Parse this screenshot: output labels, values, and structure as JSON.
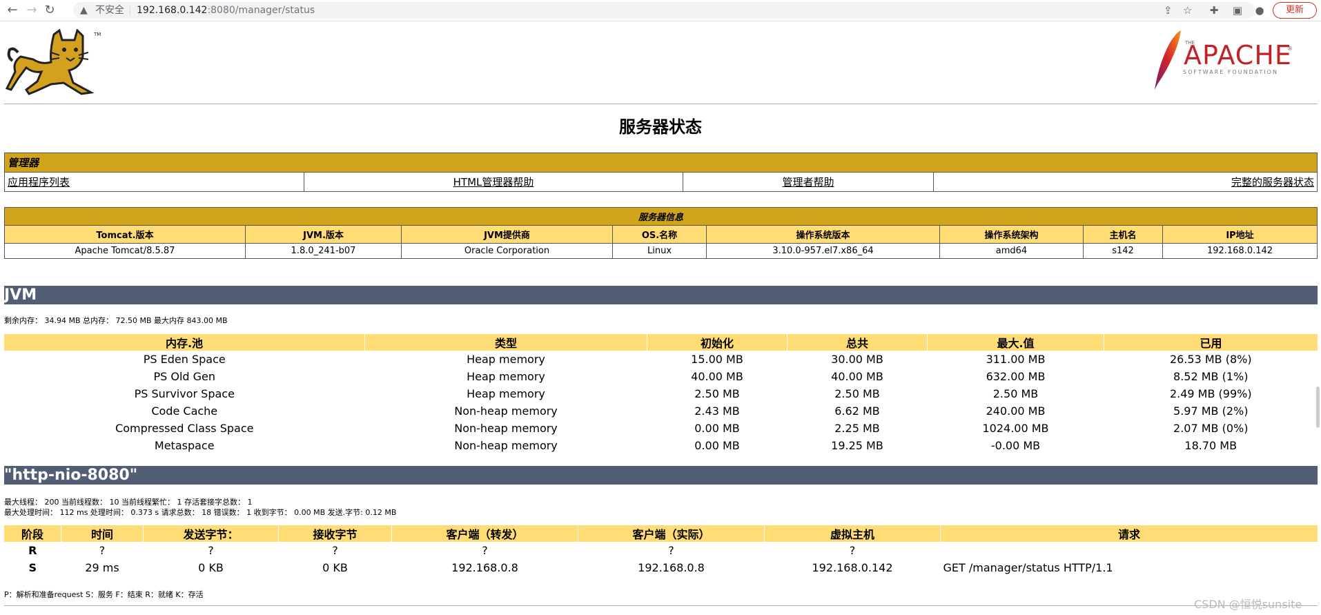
{
  "browser": {
    "security": "不安全",
    "url_host": "192.168.0.142",
    "url_path": ":8080/manager/status",
    "update_label": "更新"
  },
  "header": {
    "apache_the": "THE",
    "apache_name": "APACHE",
    "apache_sub": "SOFTWARE FOUNDATION",
    "apache_tm": "®"
  },
  "page_title": "服务器状态",
  "manager": {
    "title": "管理器",
    "links": [
      "应用程序列表",
      "HTML管理器帮助",
      "管理者帮助",
      "完整的服务器状态"
    ]
  },
  "server_info": {
    "title": "服务器信息",
    "headers": [
      "Tomcat.版本",
      "JVM.版本",
      "JVM提供商",
      "OS.名称",
      "操作系统版本",
      "操作系统架构",
      "主机名",
      "IP地址"
    ],
    "values": [
      "Apache Tomcat/8.5.87",
      "1.8.0_241-b07",
      "Oracle Corporation",
      "Linux",
      "3.10.0-957.el7.x86_64",
      "amd64",
      "s142",
      "192.168.0.142"
    ]
  },
  "jvm": {
    "title": "JVM",
    "memory_line": "剩余内存： 34.94 MB 总内存： 72.50 MB 最大内存 843.00 MB",
    "headers": [
      "内存.池",
      "类型",
      "初始化",
      "总共",
      "最大.值",
      "已用"
    ],
    "rows": [
      [
        "PS Eden Space",
        "Heap memory",
        "15.00 MB",
        "30.00 MB",
        "311.00 MB",
        "26.53 MB (8%)"
      ],
      [
        "PS Old Gen",
        "Heap memory",
        "40.00 MB",
        "40.00 MB",
        "632.00 MB",
        "8.52 MB (1%)"
      ],
      [
        "PS Survivor Space",
        "Heap memory",
        "2.50 MB",
        "2.50 MB",
        "2.50 MB",
        "2.49 MB (99%)"
      ],
      [
        "Code Cache",
        "Non-heap memory",
        "2.43 MB",
        "6.62 MB",
        "240.00 MB",
        "5.97 MB (2%)"
      ],
      [
        "Compressed Class Space",
        "Non-heap memory",
        "0.00 MB",
        "2.25 MB",
        "1024.00 MB",
        "2.07 MB (0%)"
      ],
      [
        "Metaspace",
        "Non-heap memory",
        "0.00 MB",
        "19.25 MB",
        "-0.00 MB",
        "18.70 MB"
      ]
    ]
  },
  "connector": {
    "title": "\"http-nio-8080\"",
    "line1": "最大线程： 200 当前线程数： 10 当前线程繁忙： 1 存活套接字总数： 1",
    "line2": "最大处理时间： 112 ms 处理时间： 0.373 s 请求总数： 18 错误数： 1 收到字节： 0.00 MB 发送.字节: 0.12 MB",
    "headers": [
      "阶段",
      "时间",
      "发送字节：",
      "接收字节",
      "客户端（转发）",
      "客户端（实际）",
      "虚拟主机",
      "请求"
    ],
    "rows": [
      [
        "R",
        "?",
        "?",
        "?",
        "?",
        "?",
        "?",
        ""
      ],
      [
        "S",
        "29 ms",
        "0 KB",
        "0 KB",
        "192.168.0.8",
        "192.168.0.8",
        "192.168.0.142",
        "GET /manager/status HTTP/1.1"
      ]
    ],
    "legend": "P：解析和准备request S：服务 F：结束 R：就绪 K：存活"
  },
  "watermark": "CSDN @恒悦sunsite"
}
